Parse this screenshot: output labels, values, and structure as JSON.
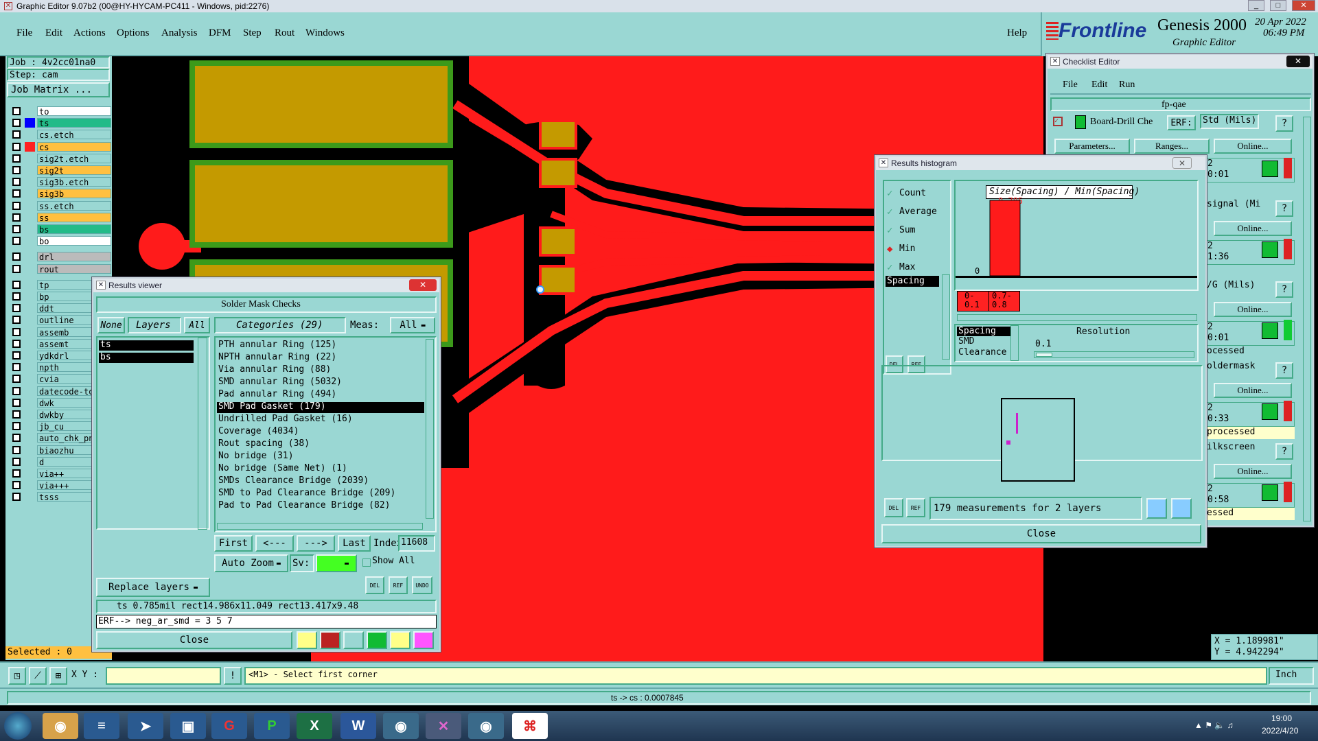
{
  "window": {
    "title": "Graphic Editor 9.07b2 (00@HY-HYCAM-PC411 - Windows, pid:2276)",
    "min": "_",
    "max": "□",
    "close": "✕"
  },
  "menu": {
    "items": [
      "File",
      "Edit",
      "Actions",
      "Options",
      "Analysis",
      "DFM",
      "Step",
      "Rout",
      "Windows"
    ],
    "help": "Help"
  },
  "brand": {
    "logo": "Frontline",
    "product": "Genesis 2000",
    "subtitle": "Graphic Editor",
    "date": "20 Apr 2022",
    "time": "06:49 PM"
  },
  "left": {
    "job": "Job : 4v2cc01na0",
    "step": "Step: cam",
    "matrix_btn": "Job Matrix ...",
    "selected": "Selected : 0",
    "layers": [
      {
        "name": "to",
        "color": "#ffffff",
        "chip": "#000000"
      },
      {
        "name": "ts",
        "color": "#22bb88",
        "chip": "#0000ff",
        "active": true
      },
      {
        "name": "cs.etch",
        "color": "#9ad7d3",
        "chip": "#000000"
      },
      {
        "name": "cs",
        "color": "#ffc040",
        "chip": "#ff2020"
      },
      {
        "name": "sig2t.etch",
        "color": "#9ad7d3",
        "chip": "#000000"
      },
      {
        "name": "sig2t",
        "color": "#ffc040",
        "chip": "#000000"
      },
      {
        "name": "sig3b.etch",
        "color": "#9ad7d3",
        "chip": "#000000"
      },
      {
        "name": "sig3b",
        "color": "#ffc040",
        "chip": "#000000"
      },
      {
        "name": "ss.etch",
        "color": "#9ad7d3",
        "chip": "#000000"
      },
      {
        "name": "ss",
        "color": "#ffc040",
        "chip": "#000000"
      },
      {
        "name": "bs",
        "color": "#22bb88",
        "chip": "#000000"
      },
      {
        "name": "bo",
        "color": "#ffffff",
        "chip": "#000000"
      },
      {
        "name": "drl",
        "color": "#bbbbbb",
        "chip": "#000000"
      },
      {
        "name": "rout",
        "color": "#bbbbbb",
        "chip": "#000000"
      },
      {
        "name": "tp",
        "color": "#9ad7d3",
        "chip": "#000000"
      },
      {
        "name": "bp",
        "color": "#9ad7d3",
        "chip": "#000000"
      },
      {
        "name": "ddt",
        "color": "#9ad7d3",
        "chip": "#000000"
      },
      {
        "name": "outline",
        "color": "#9ad7d3",
        "chip": "#000000"
      },
      {
        "name": "assemb",
        "color": "#9ad7d3",
        "chip": "#000000"
      },
      {
        "name": "assemt",
        "color": "#9ad7d3",
        "chip": "#000000"
      },
      {
        "name": "ydkdrl",
        "color": "#9ad7d3",
        "chip": "#000000"
      },
      {
        "name": "npth",
        "color": "#9ad7d3",
        "chip": "#000000"
      },
      {
        "name": "cvia",
        "color": "#9ad7d3",
        "chip": "#000000"
      },
      {
        "name": "datecode-to",
        "color": "#9ad7d3",
        "chip": "#000000"
      },
      {
        "name": "dwk",
        "color": "#9ad7d3",
        "chip": "#000000"
      },
      {
        "name": "dwkby",
        "color": "#9ad7d3",
        "chip": "#000000"
      },
      {
        "name": "jb_cu",
        "color": "#9ad7d3",
        "chip": "#000000"
      },
      {
        "name": "auto_chk_pn",
        "color": "#9ad7d3",
        "chip": "#000000"
      },
      {
        "name": "biaozhu",
        "color": "#9ad7d3",
        "chip": "#000000"
      },
      {
        "name": "d",
        "color": "#9ad7d3",
        "chip": "#000000"
      },
      {
        "name": "via++",
        "color": "#9ad7d3",
        "chip": "#000000"
      },
      {
        "name": "via+++",
        "color": "#9ad7d3",
        "chip": "#000000"
      },
      {
        "name": "tsss",
        "color": "#9ad7d3",
        "chip": "#000000"
      }
    ]
  },
  "results_viewer": {
    "title": "Results viewer",
    "heading": "Solder Mask Checks",
    "none": "None",
    "layers": "Layers",
    "all": "All",
    "categories_label": "Categories (29)",
    "meas_label": "Meas:",
    "meas_value": "All",
    "layer_list": [
      "ts",
      "bs"
    ],
    "categories": [
      "PTH annular Ring (125)",
      "NPTH annular Ring (22)",
      "Via annular Ring (88)",
      "SMD annular Ring (5032)",
      "Pad annular Ring (494)",
      "SMD Pad Gasket (179)",
      "Undrilled Pad Gasket (16)",
      "Coverage (4034)",
      "Rout spacing (38)",
      "No bridge (31)",
      "No bridge (Same Net) (1)",
      "SMDs Clearance Bridge (2039)",
      "SMD to Pad Clearance Bridge (209)",
      "Pad to Pad Clearance Bridge (82)"
    ],
    "selected_index": 5,
    "first": "First",
    "prev": "<---",
    "next": "--->",
    "last": "Last",
    "index_label": "Index:",
    "index_value": "11608",
    "auto_zoom": "Auto Zoom",
    "sv": "Sv:",
    "show_all": "Show All",
    "replace": "Replace layers",
    "info1": "ts 0.785mil  rect14.986x11.049  rect13.417x9.48",
    "info2": "ERF--> neg_ar_smd = 3 5 7",
    "close": "Close",
    "del": "DEL",
    "ref": "REF",
    "undo": "UNDO"
  },
  "checklist": {
    "title": "Checklist Editor",
    "menu": [
      "File",
      "Edit",
      "Run"
    ],
    "name": "fp-qae",
    "check": "Board-Drill Che",
    "erf": "ERF:",
    "std": "Std (Mils)",
    "parameters": "Parameters...",
    "ranges": "Ranges...",
    "online": "Online...",
    "q": "?",
    "rows": [
      {
        "label": "2",
        "time": "0:01"
      },
      {
        "label": "signal (Mi",
        "time": ""
      },
      {
        "label": "2",
        "time": "1:36"
      },
      {
        "label": "/G (Mils)",
        "time": ""
      },
      {
        "label": "2",
        "time": "0:01"
      },
      {
        "label": "ocessed",
        "time": ""
      },
      {
        "label": "oldermask",
        "time": ""
      },
      {
        "label": "2",
        "time": "0:33"
      },
      {
        "label": "processed",
        "time": ""
      },
      {
        "label": "ilkscreen",
        "time": ""
      },
      {
        "label": "2",
        "time": "0:58"
      },
      {
        "label": "essed",
        "time": ""
      }
    ]
  },
  "histogram": {
    "title": "Results histogram",
    "options": [
      "Count",
      "Average",
      "Sum",
      "Min",
      "Max"
    ],
    "selected": "Min",
    "list": [
      "Spacing"
    ],
    "chart_title": "Size(Spacing) / Min(Spacing)",
    "top_value": "0.785",
    "zero": "0",
    "chart_data": {
      "type": "bar",
      "categories": [
        "0-0.1",
        "0.7-0.8"
      ],
      "values": [
        0,
        0.785
      ],
      "title": "Size(Spacing) / Min(Spacing)"
    },
    "bins": [
      "0-\n0.1",
      "0.7-\n0.8"
    ],
    "sub_list": [
      "Spacing",
      "SMD",
      "Clearance"
    ],
    "resolution_label": "Resolution",
    "resolution_value": "0.1",
    "measurements": "179 measurements for 2 layers",
    "close": "Close",
    "del": "DEL",
    "ref": "REF"
  },
  "coords": {
    "x": "X = 1.189981\"",
    "y": "Y = 4.942294\""
  },
  "status": {
    "xy_label": "X Y :",
    "xy_value": "",
    "prompt": "<M1> - Select first corner",
    "units": "Inch",
    "info": "ts -> cs : 0.0007845"
  },
  "taskbar": {
    "time": "19:00",
    "date": "2022/4/20"
  }
}
